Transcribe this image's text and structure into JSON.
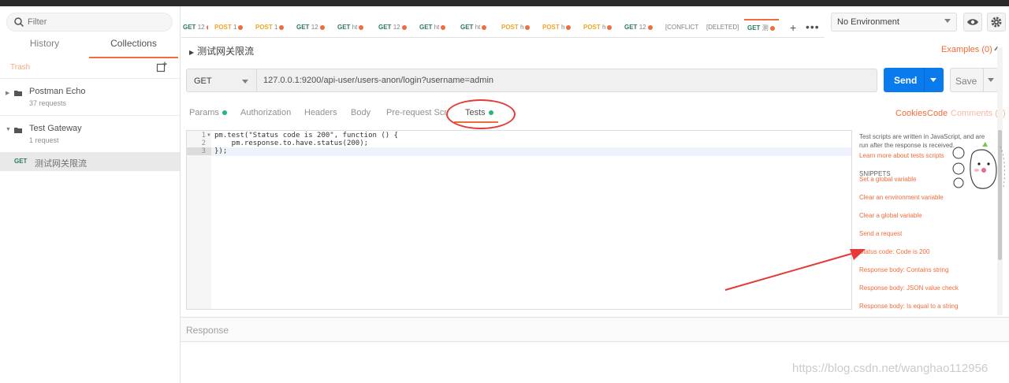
{
  "sidebar": {
    "search_placeholder": "Filter",
    "tabs": [
      "History",
      "Collections"
    ],
    "trash": "Trash",
    "collections": [
      {
        "name": "Postman Echo",
        "count": "37 requests"
      },
      {
        "name": "Test Gateway",
        "count": "1 request"
      }
    ],
    "request": {
      "method": "GET",
      "name": "测试网关限流"
    }
  },
  "tabs": [
    {
      "method": "GET",
      "text": "12",
      "color": "#2b7a5d"
    },
    {
      "method": "POST",
      "text": "1",
      "color": "#f5a623"
    },
    {
      "method": "POST",
      "text": "1",
      "color": "#f5a623"
    },
    {
      "method": "GET",
      "text": "12",
      "color": "#2b7a5d"
    },
    {
      "method": "GET",
      "text": "ht",
      "color": "#2b7a5d"
    },
    {
      "method": "GET",
      "text": "12",
      "color": "#2b7a5d"
    },
    {
      "method": "GET",
      "text": "ht",
      "color": "#2b7a5d"
    },
    {
      "method": "GET",
      "text": "ht",
      "color": "#2b7a5d"
    },
    {
      "method": "POST",
      "text": "h",
      "color": "#f5a623"
    },
    {
      "method": "POST",
      "text": "h",
      "color": "#f5a623"
    },
    {
      "method": "POST",
      "text": "h",
      "color": "#f5a623"
    },
    {
      "method": "GET",
      "text": "12",
      "color": "#2b7a5d"
    },
    {
      "method": "",
      "text": "[CONFLICT",
      "color": "#505050"
    },
    {
      "method": "",
      "text": "[DELETED]",
      "color": "#505050"
    },
    {
      "method": "GET",
      "text": "测",
      "color": "#2b7a5d"
    }
  ],
  "environment": "No Environment",
  "request": {
    "name": "测试网关限流",
    "examples": "Examples (0)",
    "method": "GET",
    "url": "127.0.0.1:9200/api-user/users-anon/login?username=admin"
  },
  "buttons": {
    "send": "Send",
    "save": "Save"
  },
  "subtabs": [
    "Params",
    "Authorization",
    "Headers",
    "Body",
    "Pre-request Script",
    "Tests"
  ],
  "right_links": {
    "cookies": "Cookies",
    "code": "Code",
    "comments": "Comments (0)"
  },
  "editor": {
    "line_numbers": [
      "1",
      "2",
      "3"
    ],
    "lines": [
      "pm.test(\"Status code is 200\", function () {",
      "    pm.response.to.have.status(200);",
      "});"
    ]
  },
  "snippets": {
    "help": "Test scripts are written in JavaScript, and are run after the response is received.",
    "learn_more": "Learn more about tests scripts",
    "heading": "SNIPPETS",
    "items": [
      "Set a global variable",
      "Clear an environment variable",
      "Clear a global variable",
      "Send a request",
      "Status code: Code is 200",
      "Response body: Contains string",
      "Response body: JSON value check",
      "Response body: Is equal to a string"
    ]
  },
  "response_label": "Response",
  "watermark": "https://blog.csdn.net/wanghao112956",
  "colors": {
    "accent": "#f26b3a",
    "send": "#097bed",
    "get": "#2b7a5d",
    "post": "#f5a623",
    "annotation": "#e53a35"
  }
}
